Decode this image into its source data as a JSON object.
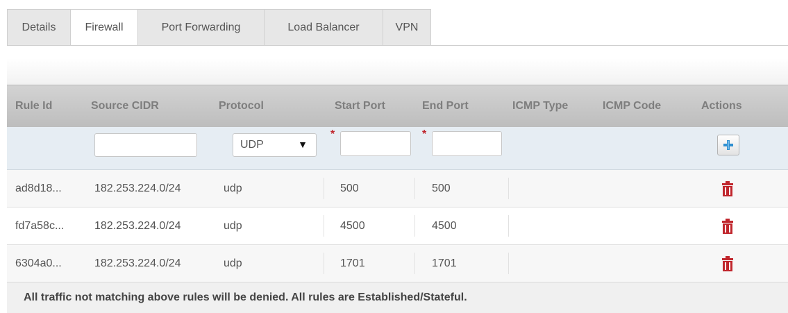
{
  "tabs": [
    {
      "label": "Details",
      "active": false
    },
    {
      "label": "Firewall",
      "active": true
    },
    {
      "label": "Port Forwarding",
      "active": false
    },
    {
      "label": "Load Balancer",
      "active": false
    },
    {
      "label": "VPN",
      "active": false
    }
  ],
  "table": {
    "columns": [
      "Rule Id",
      "Source CIDR",
      "Protocol",
      "Start Port",
      "End Port",
      "ICMP Type",
      "ICMP Code",
      "Actions"
    ],
    "new_rule": {
      "source_cidr": "",
      "protocol": "UDP",
      "start_port": "",
      "end_port": "",
      "required_marker": "*",
      "add_icon": "plus-icon"
    },
    "rows": [
      {
        "rule_id": "ad8d18...",
        "source_cidr": "182.253.224.0/24",
        "protocol": "udp",
        "start_port": "500",
        "end_port": "500",
        "icmp_type": "",
        "icmp_code": "",
        "action_icon": "trash-icon"
      },
      {
        "rule_id": "fd7a58c...",
        "source_cidr": "182.253.224.0/24",
        "protocol": "udp",
        "start_port": "4500",
        "end_port": "4500",
        "icmp_type": "",
        "icmp_code": "",
        "action_icon": "trash-icon"
      },
      {
        "rule_id": "6304a0...",
        "source_cidr": "182.253.224.0/24",
        "protocol": "udp",
        "start_port": "1701",
        "end_port": "1701",
        "icmp_type": "",
        "icmp_code": "",
        "action_icon": "trash-icon"
      }
    ]
  },
  "footer_note": "All traffic not matching above rules will be denied. All rules are Established/Stateful.",
  "colors": {
    "delete": "#c0262d",
    "add": "#2f8fd0"
  }
}
